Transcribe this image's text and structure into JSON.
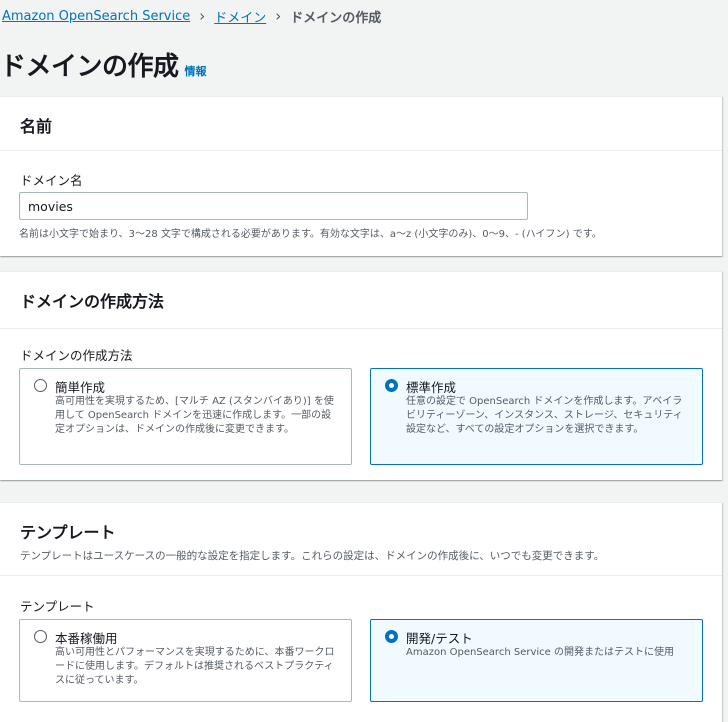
{
  "breadcrumb": {
    "items": [
      "Amazon OpenSearch Service",
      "ドメイン"
    ],
    "current": "ドメインの作成"
  },
  "page": {
    "title": "ドメインの作成",
    "info": "情報"
  },
  "name_section": {
    "heading": "名前",
    "field_label": "ドメイン名",
    "value": "movies",
    "hint": "名前は小文字で始まり、3〜28 文字で構成される必要があります。有効な文字は、a〜z (小文字のみ)、0〜9、- (ハイフン) です。"
  },
  "creation_method": {
    "heading": "ドメインの作成方法",
    "field_label": "ドメインの作成方法",
    "options": [
      {
        "title": "簡単作成",
        "desc": "高可用性を実現するため、[マルチ AZ (スタンバイあり)] を使用して OpenSearch ドメインを迅速に作成します。一部の設定オプションは、ドメインの作成後に変更できます。",
        "selected": false
      },
      {
        "title": "標準作成",
        "desc": "任意の設定で OpenSearch ドメインを作成します。アベイラビリティーゾーン、インスタンス、ストレージ、セキュリティ設定など、すべての設定オプションを選択できます。",
        "selected": true
      }
    ]
  },
  "template": {
    "heading": "テンプレート",
    "description": "テンプレートはユースケースの一般的な設定を指定します。これらの設定は、ドメインの作成後に、いつでも変更できます。",
    "field_label": "テンプレート",
    "options": [
      {
        "title": "本番稼働用",
        "desc": "高い可用性とパフォーマンスを実現するために、本番ワークロードに使用します。デフォルトは推奨されるベストプラクティスに従っています。",
        "selected": false
      },
      {
        "title": "開発/テスト",
        "desc": "Amazon OpenSearch Service の開発またはテストに使用",
        "selected": true
      }
    ]
  },
  "colors": {
    "link": "#0073bb",
    "selected_bg": "#f1faff",
    "border": "#aab7b8",
    "page_bg": "#f2f3f3"
  }
}
